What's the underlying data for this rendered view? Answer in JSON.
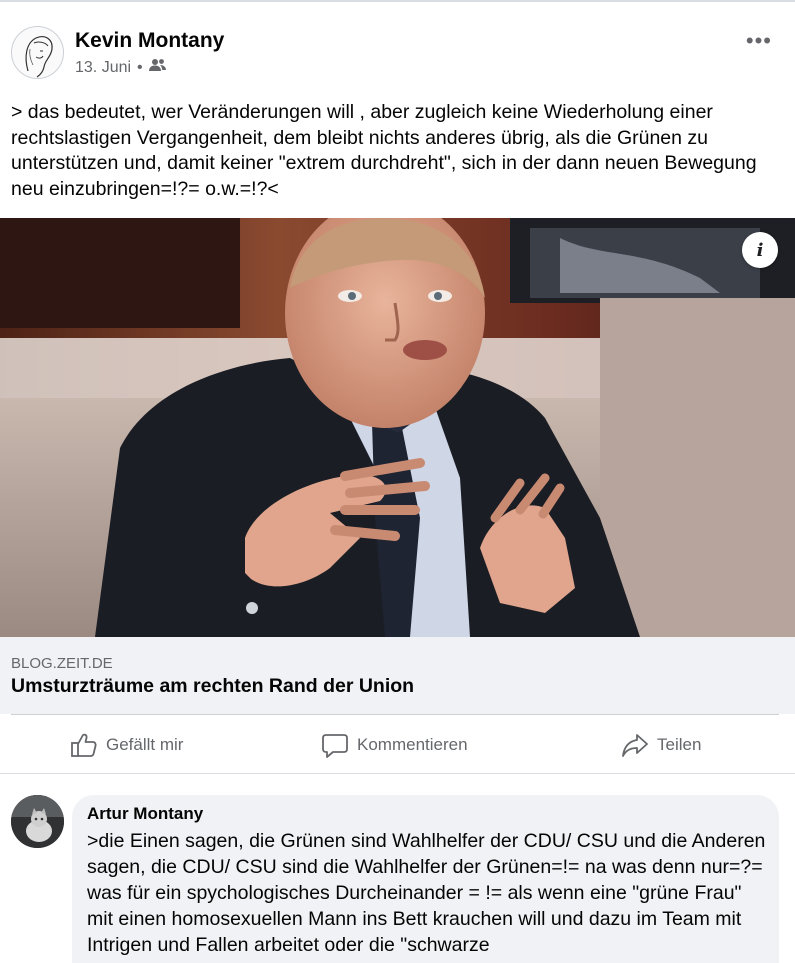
{
  "post": {
    "author": "Kevin Montany",
    "date": "13. Juni",
    "date_separator": "•",
    "audience_icon": "friends-icon",
    "more_label": "•••",
    "text": "> das bedeutet, wer Veränderungen will , aber zugleich keine Wiederholung einer rechtslastigen Vergangenheit, dem bleibt nichts anderes übrig, als die Grünen zu unterstützen und, damit keiner \"extrem durchdreht\", sich in der dann neuen Bewegung neu einzubringen=!?= o.w.=!?<"
  },
  "link": {
    "domain": "BLOG.ZEIT.DE",
    "title": "Umsturzträume am rechten Rand der Union",
    "info_label": "i"
  },
  "actions": {
    "like": "Gefällt mir",
    "comment": "Kommentieren",
    "share": "Teilen"
  },
  "comment": {
    "author": "Artur Montany",
    "text": ">die Einen sagen, die Grünen sind Wahlhelfer der CDU/ CSU und die Anderen sagen, die CDU/ CSU sind die Wahlhelfer der Grünen=!= na was denn nur=?= was für ein spychologisches  Durcheinander = != als wenn eine \"grüne Frau\" mit einen homosexuellen Mann ins Bett krauchen will und dazu im Team mit Intrigen und  Fallen arbeitet oder die \"schwarze"
  },
  "colors": {
    "text_primary": "#050505",
    "text_secondary": "#65676b",
    "card_bg": "#f0f2f5",
    "divider": "#ced0d4"
  }
}
